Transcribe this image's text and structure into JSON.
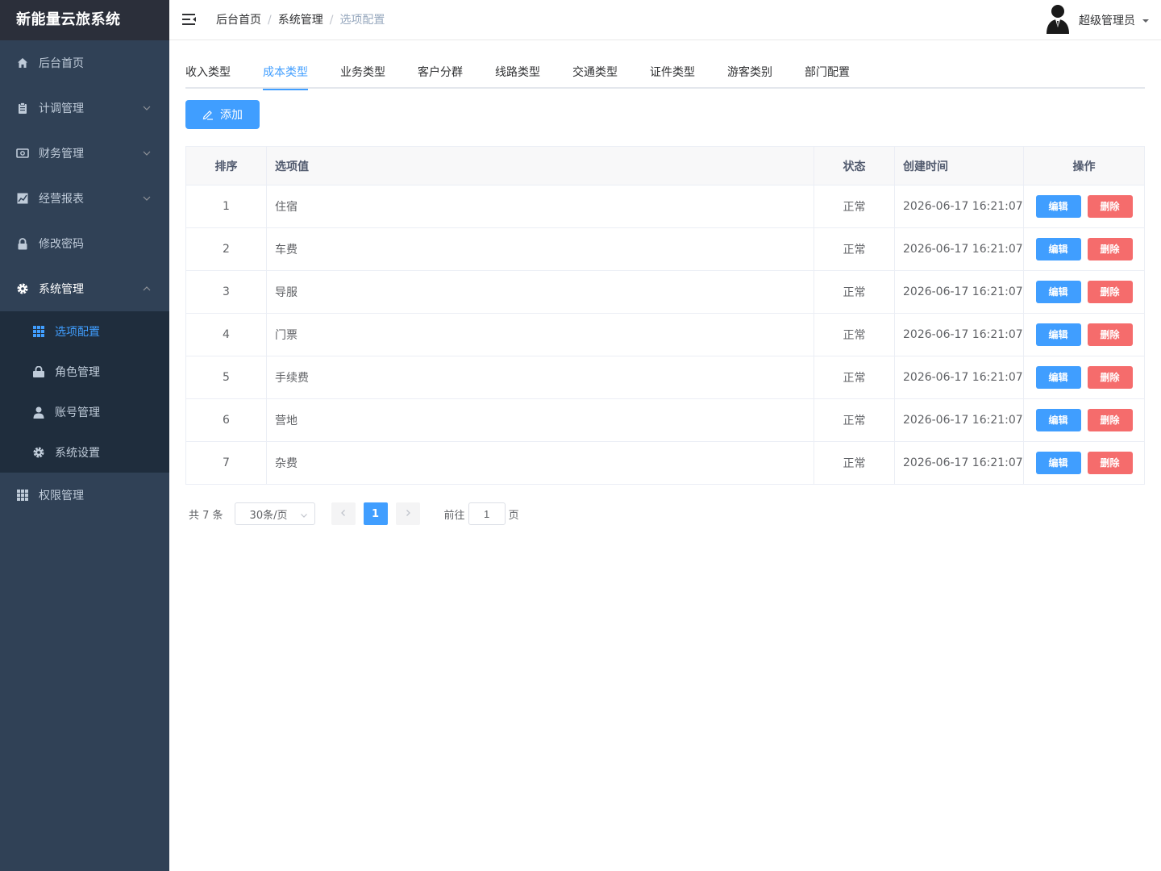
{
  "app": {
    "title": "新能量云旅系统"
  },
  "sidebar": {
    "items": [
      {
        "label": "后台首页",
        "icon": "home-icon"
      },
      {
        "label": "计调管理",
        "icon": "clipboard-icon"
      },
      {
        "label": "财务管理",
        "icon": "finance-icon"
      },
      {
        "label": "经营报表",
        "icon": "chart-icon"
      },
      {
        "label": "修改密码",
        "icon": "lock-icon"
      },
      {
        "label": "系统管理",
        "icon": "gear-icon"
      },
      {
        "label": "权限管理",
        "icon": "grid-icon"
      }
    ],
    "sub": [
      {
        "label": "选项配置",
        "icon": "grid-icon"
      },
      {
        "label": "角色管理",
        "icon": "lock-icon"
      },
      {
        "label": "账号管理",
        "icon": "user-icon"
      },
      {
        "label": "系统设置",
        "icon": "gear-icon"
      }
    ]
  },
  "header": {
    "breadcrumb": [
      "后台首页",
      "系统管理",
      "选项配置"
    ],
    "user": "超级管理员"
  },
  "tabs": [
    "收入类型",
    "成本类型",
    "业务类型",
    "客户分群",
    "线路类型",
    "交通类型",
    "证件类型",
    "游客类别",
    "部门配置"
  ],
  "active_tab": "成本类型",
  "add_button": "添加",
  "table": {
    "headers": [
      "排序",
      "选项值",
      "状态",
      "创建时间",
      "操作"
    ],
    "rows": [
      {
        "idx": "1",
        "value": "住宿",
        "status": "正常",
        "time": "2026-06-17 16:21:07"
      },
      {
        "idx": "2",
        "value": "车费",
        "status": "正常",
        "time": "2026-06-17 16:21:07"
      },
      {
        "idx": "3",
        "value": "导服",
        "status": "正常",
        "time": "2026-06-17 16:21:07"
      },
      {
        "idx": "4",
        "value": "门票",
        "status": "正常",
        "time": "2026-06-17 16:21:07"
      },
      {
        "idx": "5",
        "value": "手续费",
        "status": "正常",
        "time": "2026-06-17 16:21:07"
      },
      {
        "idx": "6",
        "value": "营地",
        "status": "正常",
        "time": "2026-06-17 16:21:07"
      },
      {
        "idx": "7",
        "value": "杂费",
        "status": "正常",
        "time": "2026-06-17 16:21:07"
      }
    ],
    "edit_label": "编辑",
    "delete_label": "删除"
  },
  "pagination": {
    "total": "共 7 条",
    "page_size": "30条/页",
    "current": "1",
    "goto_prefix": "前往",
    "goto_value": "1",
    "goto_suffix": "页"
  },
  "colors": {
    "primary": "#409eff",
    "danger": "#f56c6c",
    "sidebar": "#304156",
    "submenu": "#1f2d3d"
  }
}
